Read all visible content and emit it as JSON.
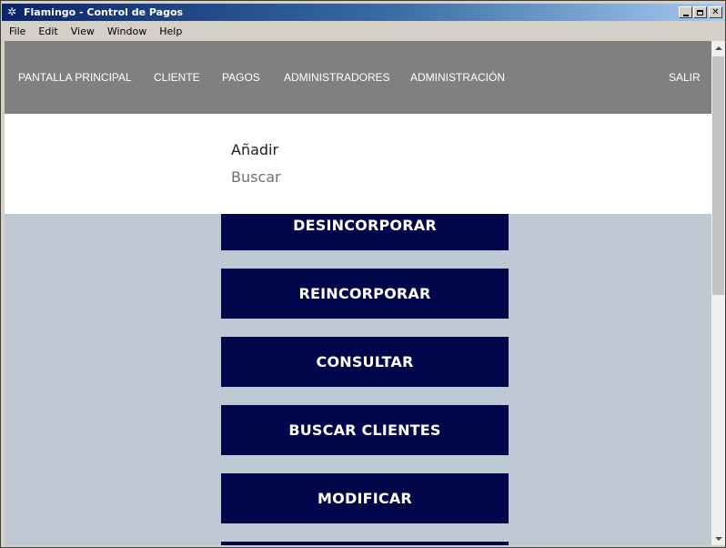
{
  "window": {
    "title": "Flamingo - Control de Pagos",
    "icon": "flamingo-app-icon",
    "controls": {
      "minimize": "minimize-icon",
      "maximize": "maximize-icon",
      "close": "close-icon"
    }
  },
  "menubar": {
    "items": [
      "File",
      "Edit",
      "View",
      "Window",
      "Help"
    ]
  },
  "nav": {
    "items": [
      "PANTALLA PRINCIPAL",
      "CLIENTE",
      "PAGOS",
      "ADMINISTRADORES",
      "ADMINISTRACIÓN"
    ],
    "logout": "SALIR"
  },
  "dropdown": {
    "items": [
      "Añadir",
      "Buscar"
    ]
  },
  "actions": {
    "buttons": [
      "DESINCORPORAR",
      "REINCORPORAR",
      "CONSULTAR",
      "BUSCAR CLIENTES",
      "MODIFICAR"
    ]
  },
  "colors": {
    "nav_bg": "#808080",
    "page_bg": "#bfc9d4",
    "button_bg": "#00064a",
    "button_text": "#ffffff",
    "dropdown_active_text": "#202020",
    "dropdown_muted_text": "#707070"
  }
}
